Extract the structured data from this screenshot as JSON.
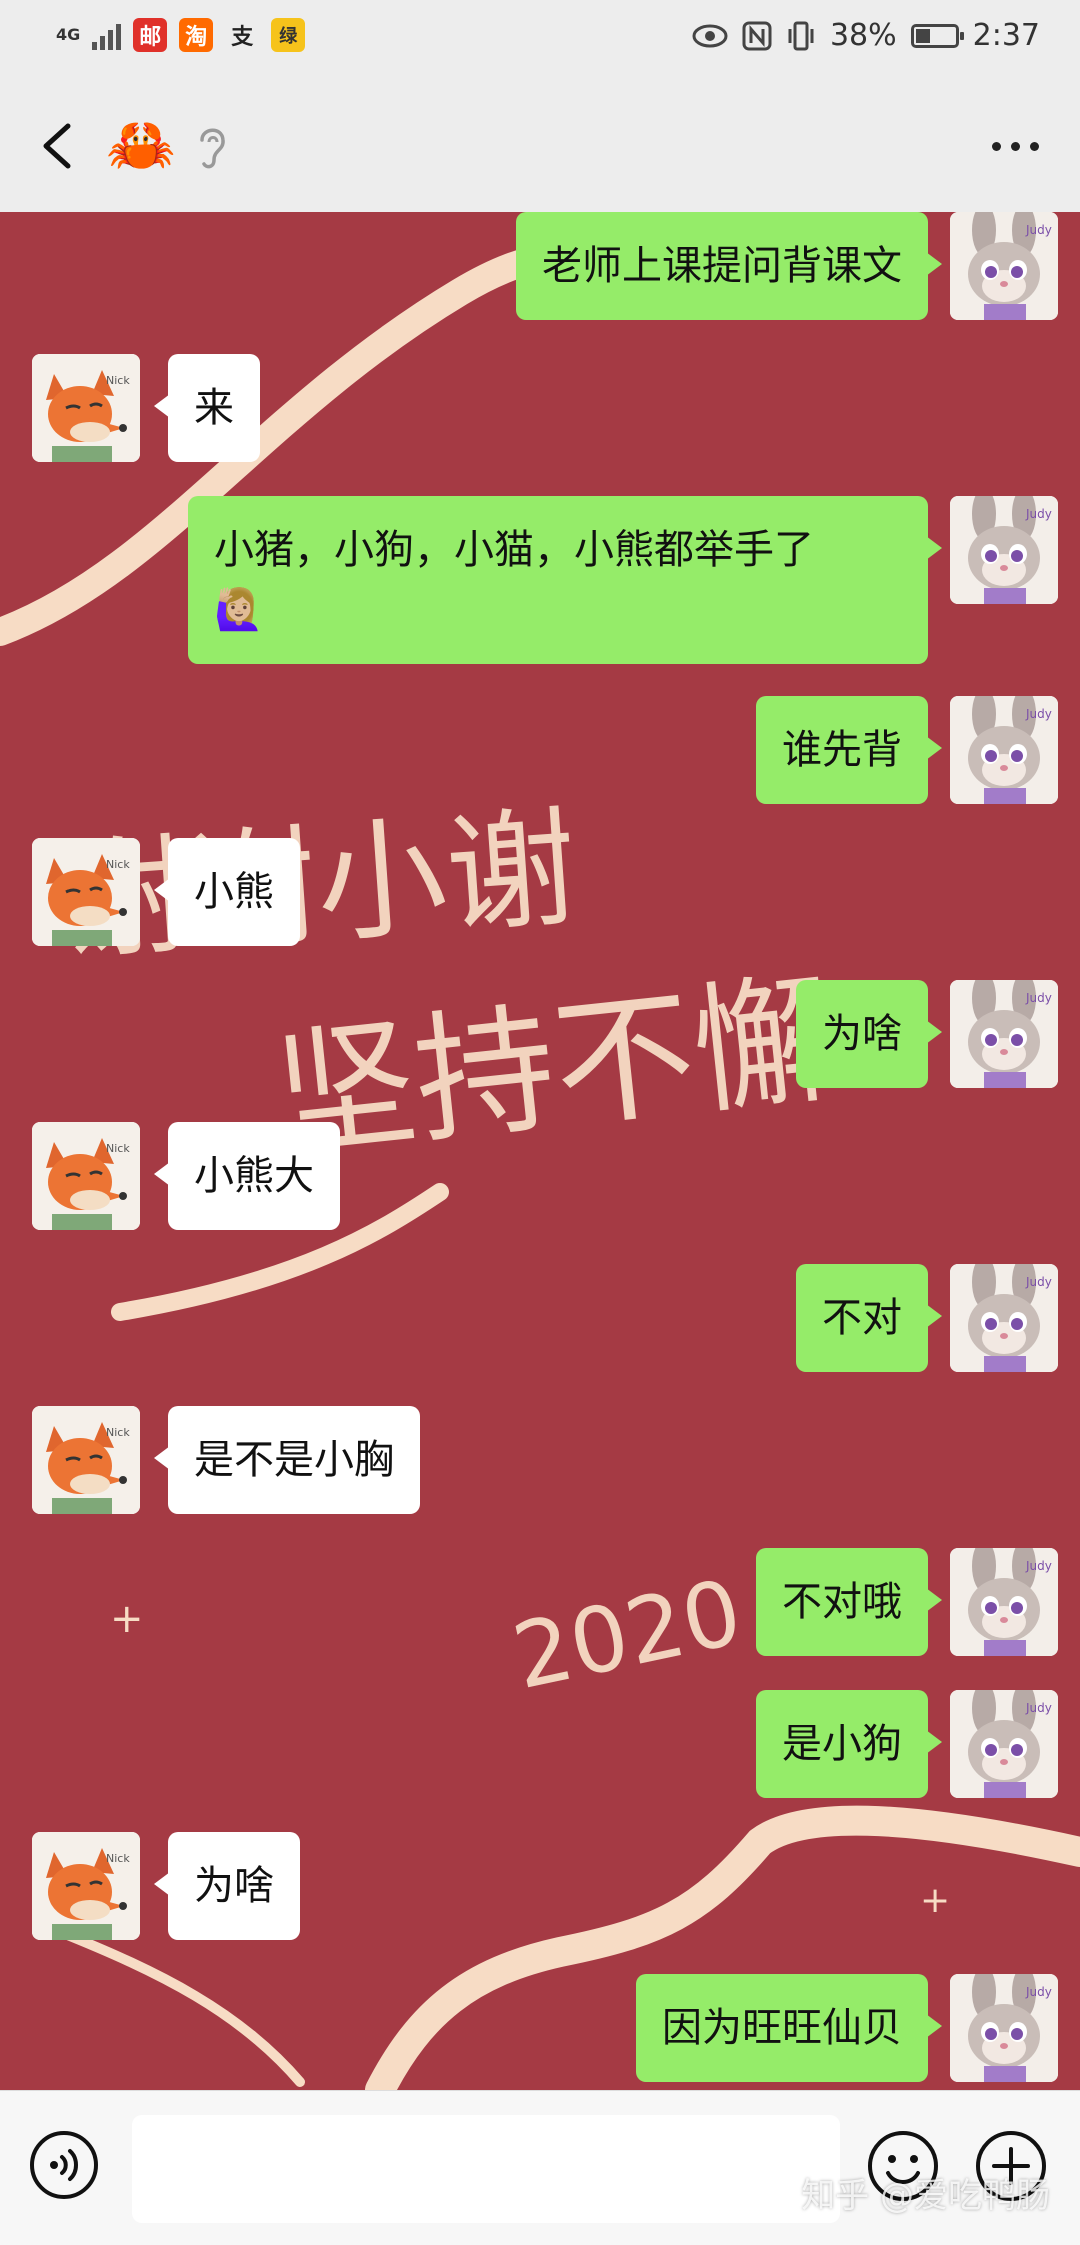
{
  "status_bar": {
    "network": "4G",
    "battery": "38%",
    "battery_level": 0.38,
    "time": "2:37",
    "app_icons": [
      "邮",
      "淘",
      "支",
      "绿"
    ]
  },
  "title_bar": {
    "title_emoji": "🦀"
  },
  "background_text": {
    "line1": "谢谢小谢",
    "line2": "坚持不懈",
    "year": "2020"
  },
  "messages": [
    {
      "side": "sent",
      "text": "老师上课提问背课文"
    },
    {
      "side": "recv",
      "text": "来"
    },
    {
      "side": "sent",
      "text": "小猪，小狗，小猫，小熊都举手了\n🙋🏼‍♀️"
    },
    {
      "side": "sent",
      "text": "谁先背"
    },
    {
      "side": "recv",
      "text": "小熊"
    },
    {
      "side": "sent",
      "text": "为啥"
    },
    {
      "side": "recv",
      "text": "小熊大"
    },
    {
      "side": "sent",
      "text": "不对"
    },
    {
      "side": "recv",
      "text": "是不是小胸"
    },
    {
      "side": "sent",
      "text": "不对哦"
    },
    {
      "side": "sent",
      "text": "是小狗"
    },
    {
      "side": "recv",
      "text": "为啥"
    },
    {
      "side": "sent",
      "text": "因为旺旺仙贝"
    }
  ],
  "input_bar": {
    "value": "",
    "placeholder": ""
  },
  "watermark": "知乎 @爱吃鸭肠",
  "colors": {
    "sent_bubble": "#95ec69",
    "recv_bubble": "#ffffff",
    "chat_background": "#a53a44"
  }
}
